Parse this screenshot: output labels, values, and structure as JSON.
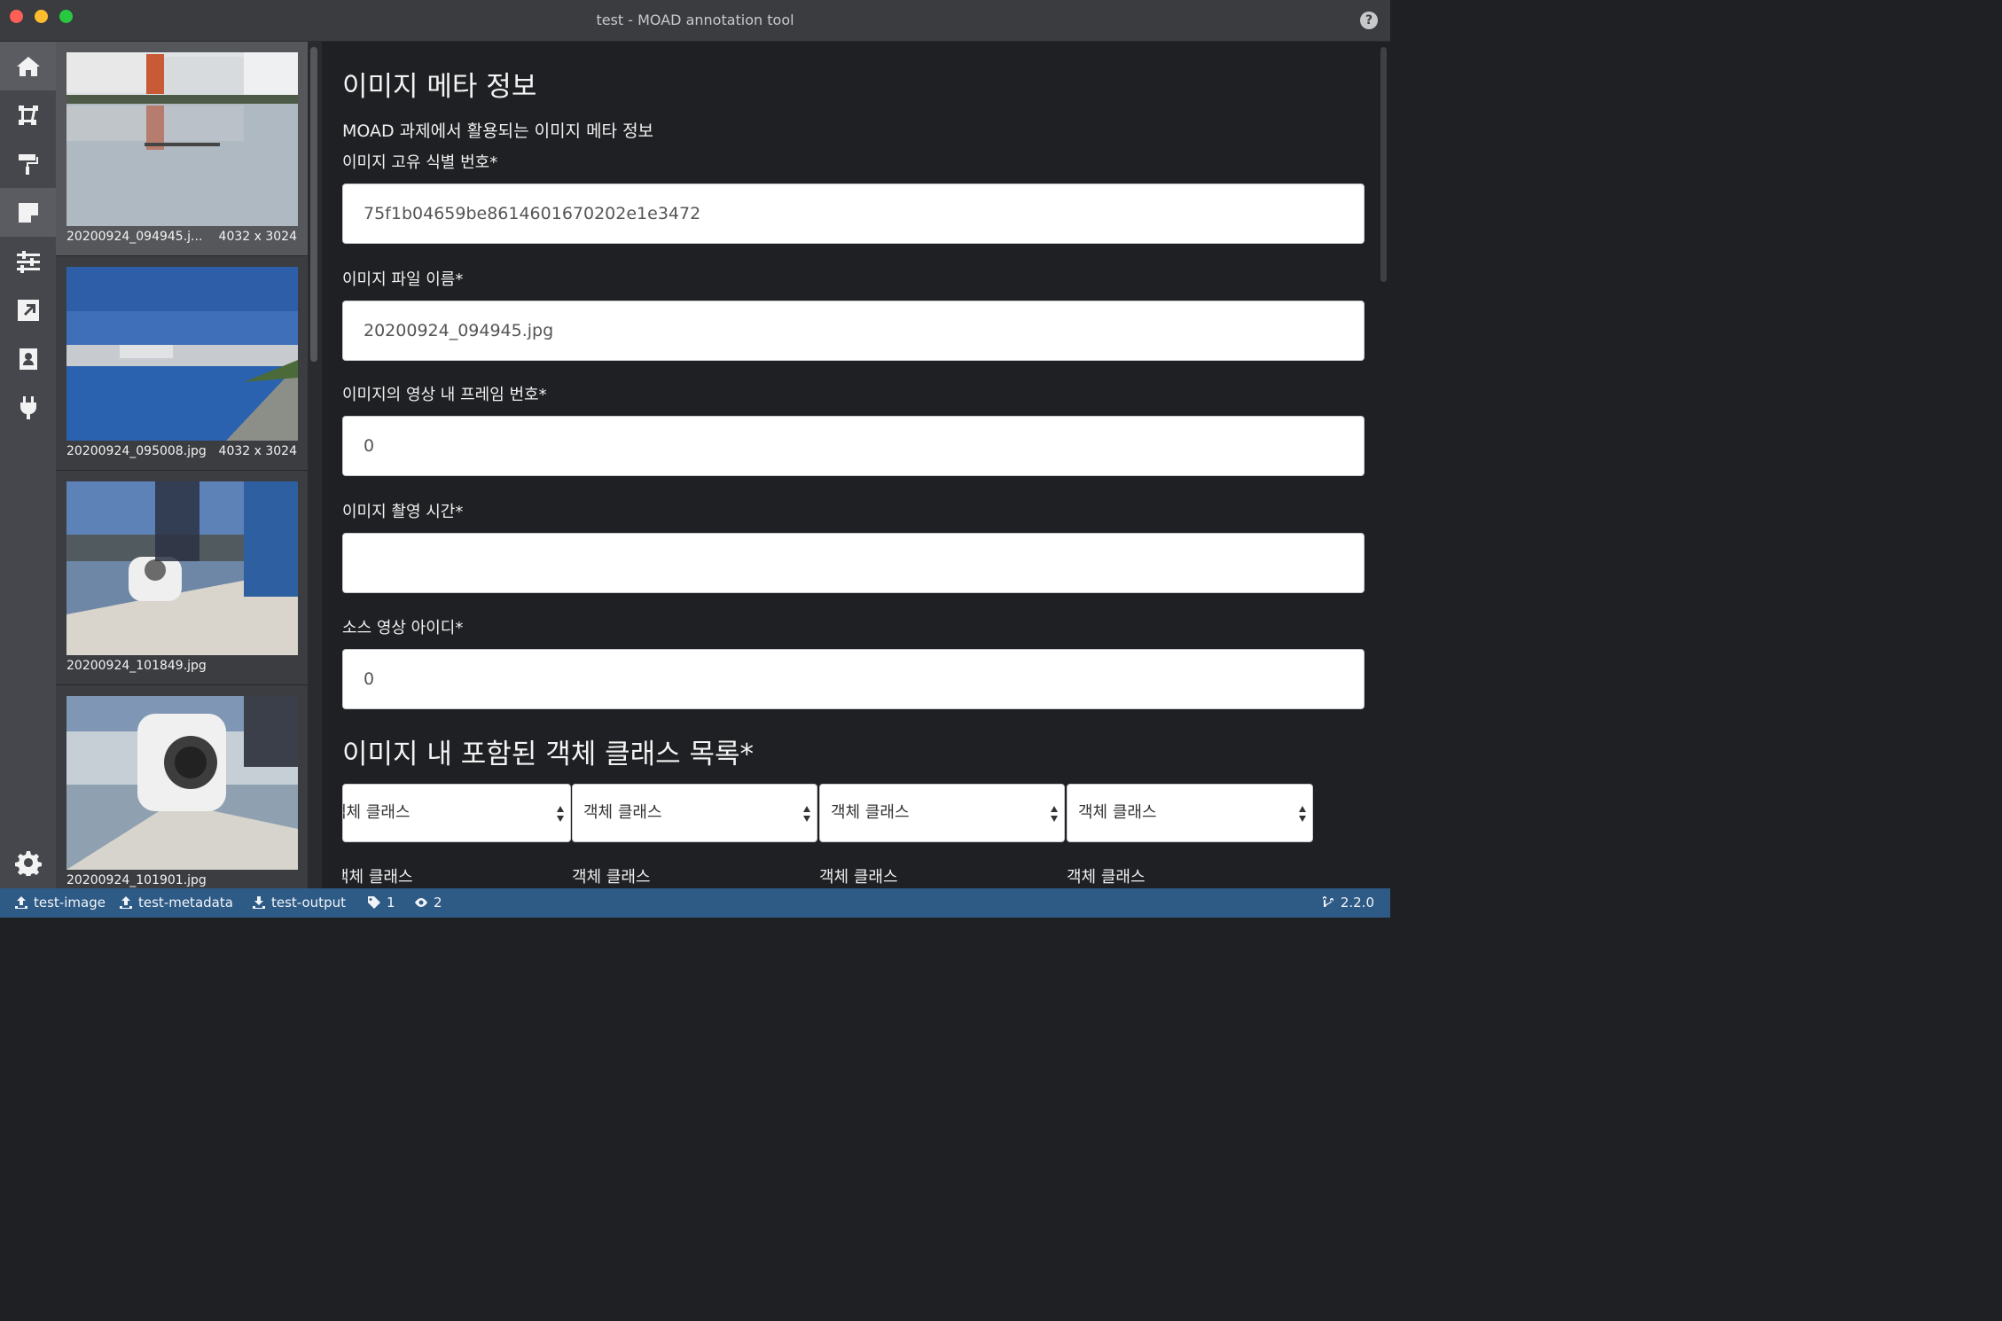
{
  "window": {
    "title": "test - MOAD annotation tool"
  },
  "iconbar": {
    "items": [
      {
        "icon": "home-icon"
      },
      {
        "icon": "polygon-icon"
      },
      {
        "icon": "paint-roller-icon"
      },
      {
        "icon": "note-icon"
      },
      {
        "icon": "sliders-icon"
      },
      {
        "icon": "export-icon"
      },
      {
        "icon": "contact-icon"
      },
      {
        "icon": "plug-icon"
      }
    ],
    "settings_icon": "gear-icon"
  },
  "thumbnails": [
    {
      "name": "20200924_094945.j...",
      "dims": "4032 x 3024",
      "selected": true
    },
    {
      "name": "20200924_095008.jpg",
      "dims": "4032 x 3024",
      "selected": false
    },
    {
      "name": "20200924_101849.jpg",
      "dims": "",
      "selected": false
    },
    {
      "name": "20200924_101901.jpg",
      "dims": "",
      "selected": false
    }
  ],
  "form": {
    "heading": "이미지 메타 정보",
    "description": "MOAD 과제에서 활용되는 이미지 메타 정보",
    "fields": [
      {
        "label": "이미지 고유 식별 번호*",
        "value": "75f1b04659be8614601670202e1e3472"
      },
      {
        "label": "이미지 파일 이름*",
        "value": "20200924_094945.jpg"
      },
      {
        "label": "이미지의 영상 내 프레임 번호*",
        "value": "0"
      },
      {
        "label": "이미지 촬영 시간*",
        "value": ""
      },
      {
        "label": "소스 영상 아이디*",
        "value": "0"
      }
    ],
    "class_list_heading": "이미지 내 포함된 객체 클래스 목록*",
    "class_selects": [
      {
        "value": "객체 클래스",
        "label": "객체 클래스"
      },
      {
        "value": "객체 클래스",
        "label": "객체 클래스"
      },
      {
        "value": "객체 클래스",
        "label": "객체 클래스"
      },
      {
        "value": "객체 클래스",
        "label": "객체 클래스"
      }
    ]
  },
  "statusbar": {
    "image_dir": "test-image",
    "metadata_dir": "test-metadata",
    "output_dir": "test-output",
    "tag_count": "1",
    "view_count": "2",
    "version": "2.2.0"
  }
}
